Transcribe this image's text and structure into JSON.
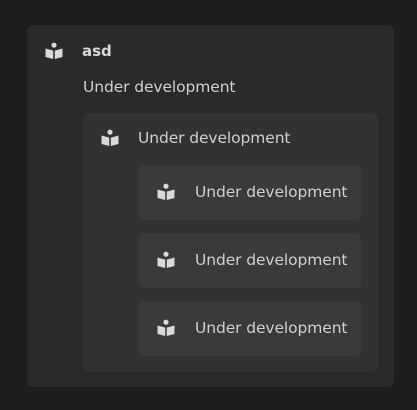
{
  "root": {
    "title": "asd",
    "icon": "book-reader-icon",
    "description": "Under development",
    "child": {
      "label": "Under development",
      "icon": "book-reader-icon",
      "items": [
        {
          "label": "Under development",
          "icon": "book-reader-icon"
        },
        {
          "label": "Under development",
          "icon": "book-reader-icon"
        },
        {
          "label": "Under development",
          "icon": "book-reader-icon"
        }
      ]
    }
  },
  "colors": {
    "background": "#1d1d1f",
    "outer_card": "#2a2a2d",
    "inner_card": "#323235",
    "sub_card": "#3a3a3d",
    "text": "#d0d0d2"
  }
}
